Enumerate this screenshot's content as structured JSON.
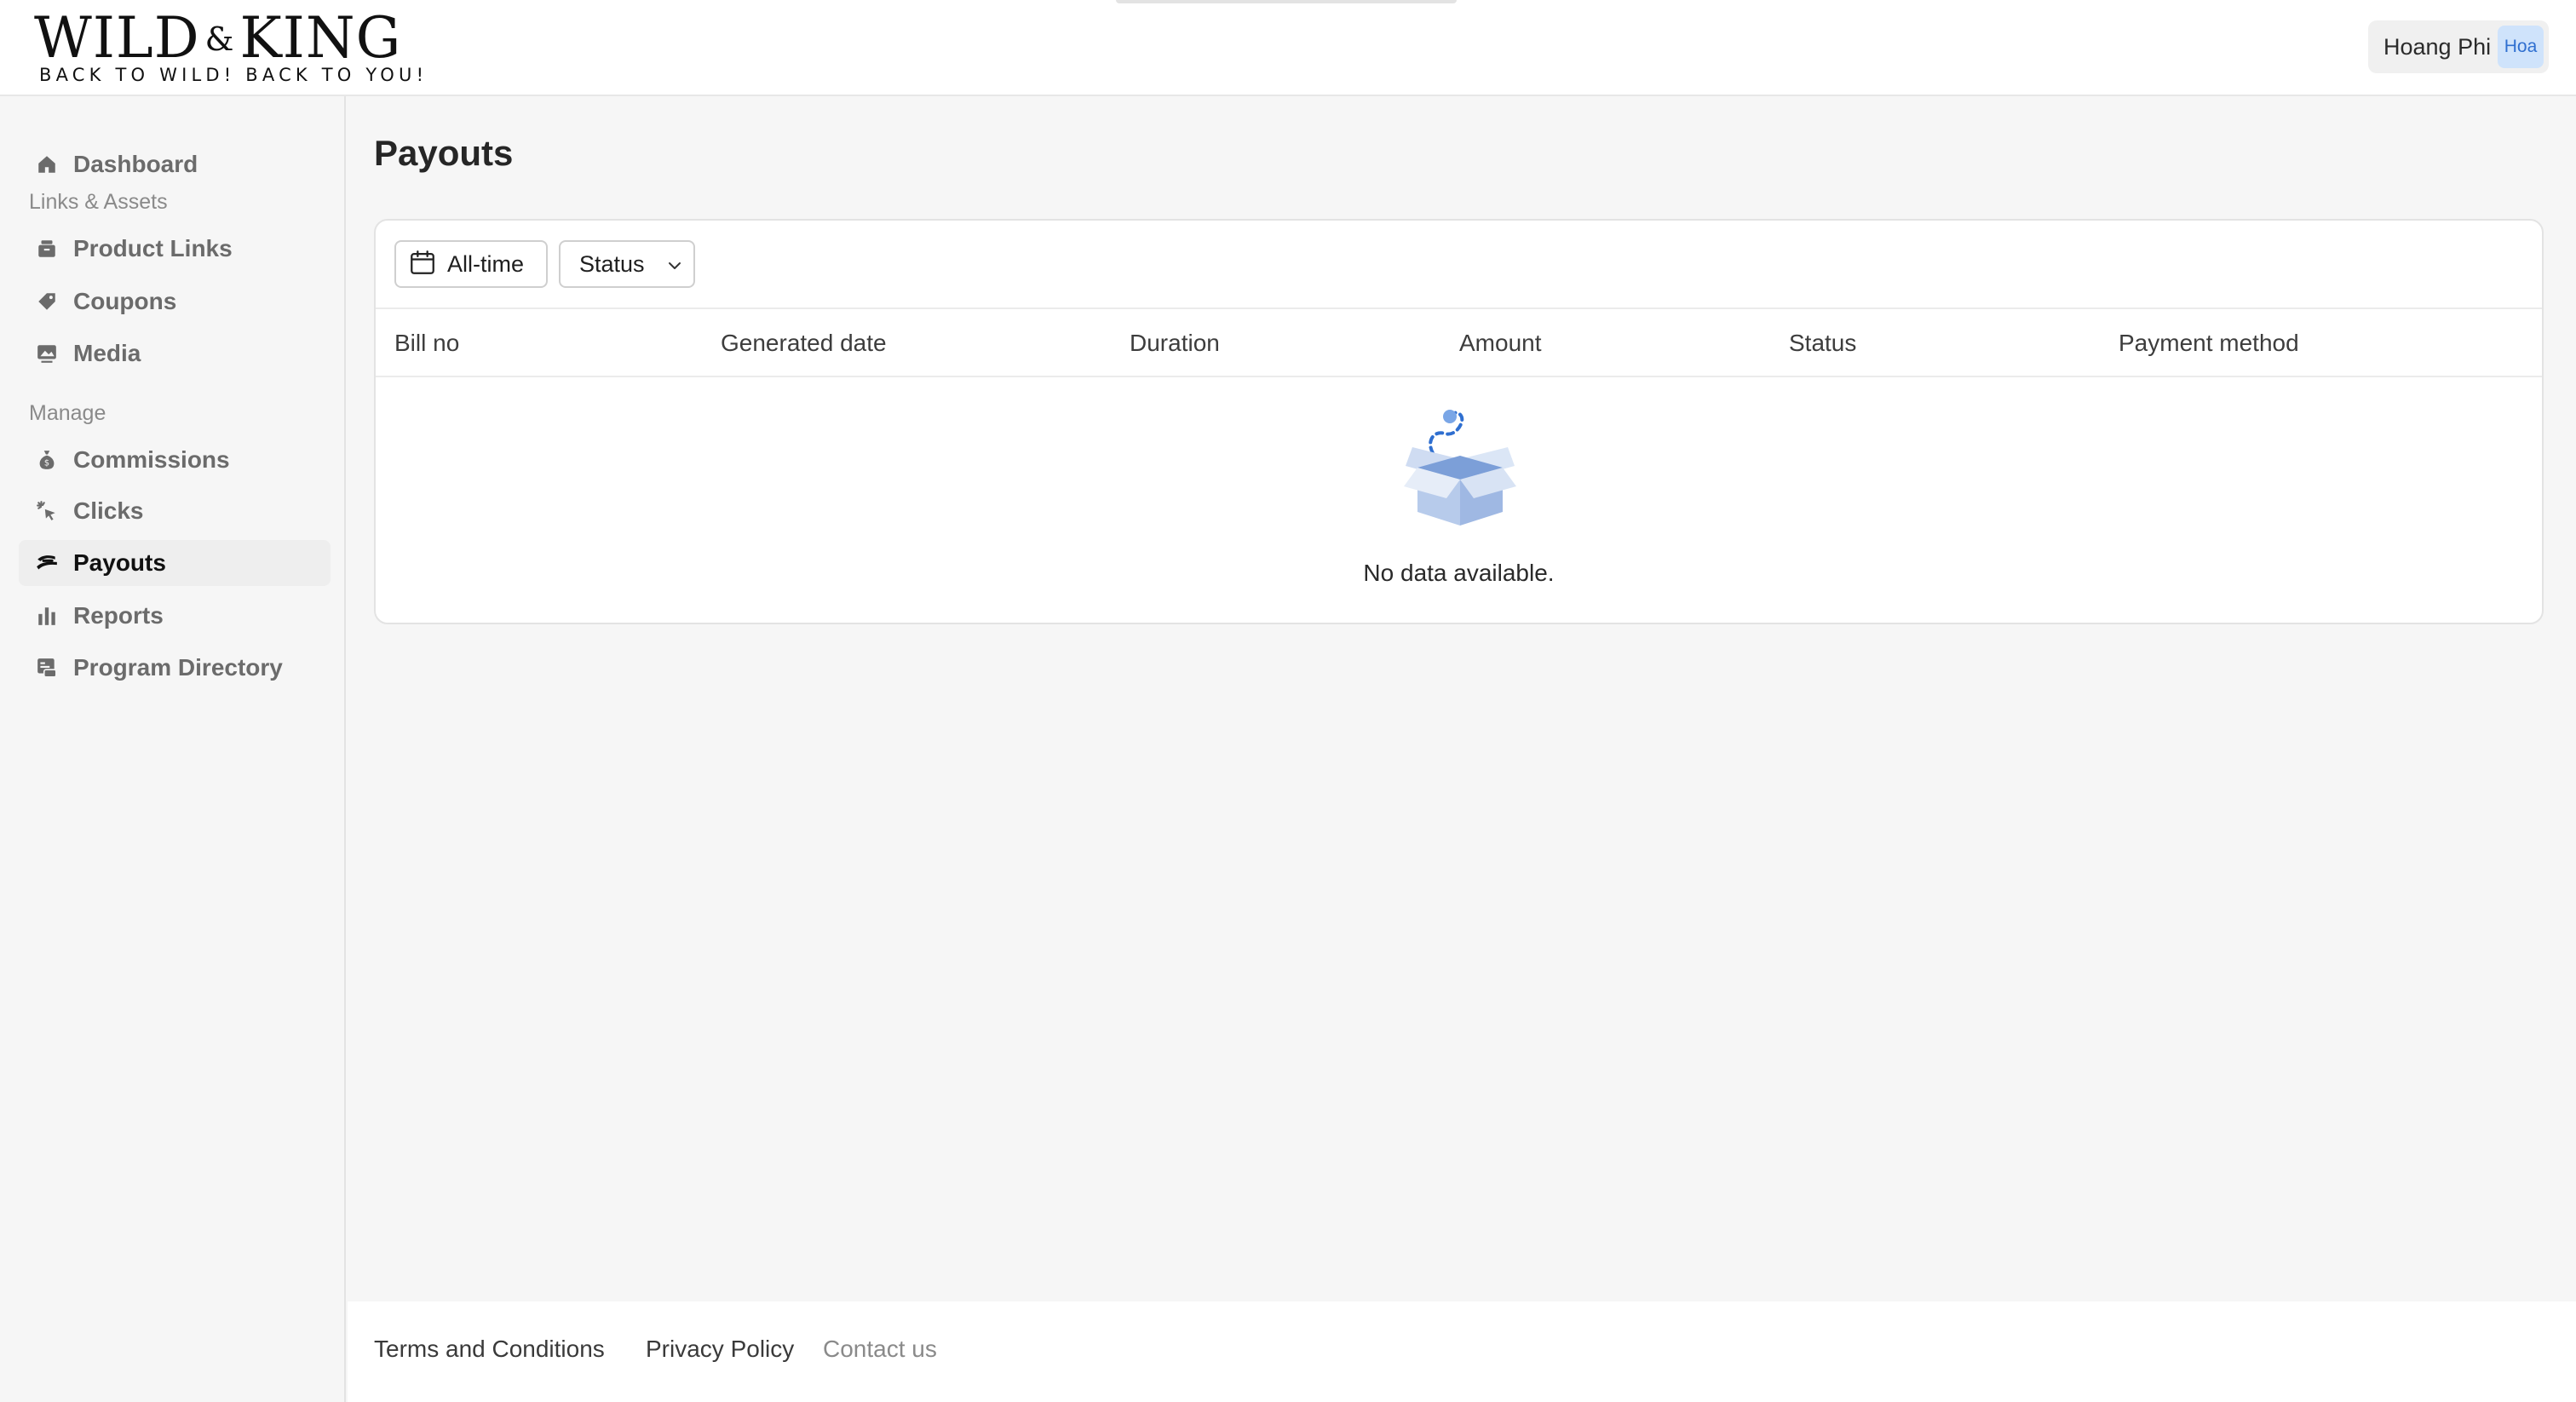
{
  "brand": {
    "logo_main_left": "WILD",
    "logo_amp": "&",
    "logo_main_right": "KING",
    "tagline": "BACK TO WILD! BACK TO YOU!"
  },
  "user": {
    "name": "Hoang Phi",
    "avatar_text": "Hoa"
  },
  "sidebar": {
    "dashboard": "Dashboard",
    "section_links": "Links & Assets",
    "product_links": "Product Links",
    "coupons": "Coupons",
    "media": "Media",
    "section_manage": "Manage",
    "commissions": "Commissions",
    "clicks": "Clicks",
    "payouts": "Payouts",
    "reports": "Reports",
    "program_directory": "Program Directory",
    "active_item": "payouts"
  },
  "page": {
    "title": "Payouts"
  },
  "filters": {
    "date_label": "All-time",
    "status_label": "Status"
  },
  "table": {
    "headers": [
      "Bill no",
      "Generated date",
      "Duration",
      "Amount",
      "Status",
      "Payment method"
    ],
    "rows": [],
    "empty_text": "No data available."
  },
  "footer": {
    "terms": "Terms and Conditions",
    "privacy": "Privacy Policy",
    "contact": "Contact us"
  },
  "colors": {
    "accent_blue": "#2f6fd0",
    "avatar_bg": "#cfe3fb",
    "sidebar_bg": "#f6f6f6"
  }
}
